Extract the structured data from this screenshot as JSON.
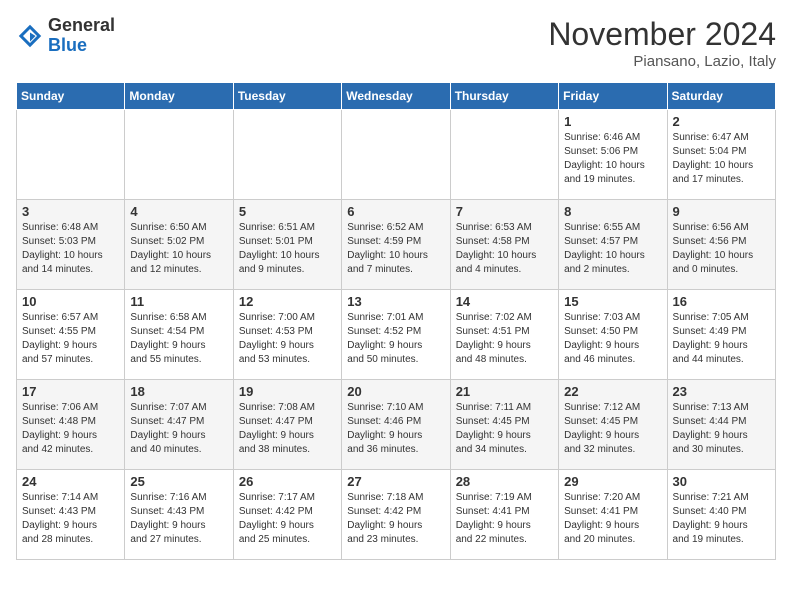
{
  "header": {
    "logo_general": "General",
    "logo_blue": "Blue",
    "month_title": "November 2024",
    "subtitle": "Piansano, Lazio, Italy"
  },
  "weekdays": [
    "Sunday",
    "Monday",
    "Tuesday",
    "Wednesday",
    "Thursday",
    "Friday",
    "Saturday"
  ],
  "weeks": [
    [
      {
        "day": "",
        "info": ""
      },
      {
        "day": "",
        "info": ""
      },
      {
        "day": "",
        "info": ""
      },
      {
        "day": "",
        "info": ""
      },
      {
        "day": "",
        "info": ""
      },
      {
        "day": "1",
        "info": "Sunrise: 6:46 AM\nSunset: 5:06 PM\nDaylight: 10 hours\nand 19 minutes."
      },
      {
        "day": "2",
        "info": "Sunrise: 6:47 AM\nSunset: 5:04 PM\nDaylight: 10 hours\nand 17 minutes."
      }
    ],
    [
      {
        "day": "3",
        "info": "Sunrise: 6:48 AM\nSunset: 5:03 PM\nDaylight: 10 hours\nand 14 minutes."
      },
      {
        "day": "4",
        "info": "Sunrise: 6:50 AM\nSunset: 5:02 PM\nDaylight: 10 hours\nand 12 minutes."
      },
      {
        "day": "5",
        "info": "Sunrise: 6:51 AM\nSunset: 5:01 PM\nDaylight: 10 hours\nand 9 minutes."
      },
      {
        "day": "6",
        "info": "Sunrise: 6:52 AM\nSunset: 4:59 PM\nDaylight: 10 hours\nand 7 minutes."
      },
      {
        "day": "7",
        "info": "Sunrise: 6:53 AM\nSunset: 4:58 PM\nDaylight: 10 hours\nand 4 minutes."
      },
      {
        "day": "8",
        "info": "Sunrise: 6:55 AM\nSunset: 4:57 PM\nDaylight: 10 hours\nand 2 minutes."
      },
      {
        "day": "9",
        "info": "Sunrise: 6:56 AM\nSunset: 4:56 PM\nDaylight: 10 hours\nand 0 minutes."
      }
    ],
    [
      {
        "day": "10",
        "info": "Sunrise: 6:57 AM\nSunset: 4:55 PM\nDaylight: 9 hours\nand 57 minutes."
      },
      {
        "day": "11",
        "info": "Sunrise: 6:58 AM\nSunset: 4:54 PM\nDaylight: 9 hours\nand 55 minutes."
      },
      {
        "day": "12",
        "info": "Sunrise: 7:00 AM\nSunset: 4:53 PM\nDaylight: 9 hours\nand 53 minutes."
      },
      {
        "day": "13",
        "info": "Sunrise: 7:01 AM\nSunset: 4:52 PM\nDaylight: 9 hours\nand 50 minutes."
      },
      {
        "day": "14",
        "info": "Sunrise: 7:02 AM\nSunset: 4:51 PM\nDaylight: 9 hours\nand 48 minutes."
      },
      {
        "day": "15",
        "info": "Sunrise: 7:03 AM\nSunset: 4:50 PM\nDaylight: 9 hours\nand 46 minutes."
      },
      {
        "day": "16",
        "info": "Sunrise: 7:05 AM\nSunset: 4:49 PM\nDaylight: 9 hours\nand 44 minutes."
      }
    ],
    [
      {
        "day": "17",
        "info": "Sunrise: 7:06 AM\nSunset: 4:48 PM\nDaylight: 9 hours\nand 42 minutes."
      },
      {
        "day": "18",
        "info": "Sunrise: 7:07 AM\nSunset: 4:47 PM\nDaylight: 9 hours\nand 40 minutes."
      },
      {
        "day": "19",
        "info": "Sunrise: 7:08 AM\nSunset: 4:47 PM\nDaylight: 9 hours\nand 38 minutes."
      },
      {
        "day": "20",
        "info": "Sunrise: 7:10 AM\nSunset: 4:46 PM\nDaylight: 9 hours\nand 36 minutes."
      },
      {
        "day": "21",
        "info": "Sunrise: 7:11 AM\nSunset: 4:45 PM\nDaylight: 9 hours\nand 34 minutes."
      },
      {
        "day": "22",
        "info": "Sunrise: 7:12 AM\nSunset: 4:45 PM\nDaylight: 9 hours\nand 32 minutes."
      },
      {
        "day": "23",
        "info": "Sunrise: 7:13 AM\nSunset: 4:44 PM\nDaylight: 9 hours\nand 30 minutes."
      }
    ],
    [
      {
        "day": "24",
        "info": "Sunrise: 7:14 AM\nSunset: 4:43 PM\nDaylight: 9 hours\nand 28 minutes."
      },
      {
        "day": "25",
        "info": "Sunrise: 7:16 AM\nSunset: 4:43 PM\nDaylight: 9 hours\nand 27 minutes."
      },
      {
        "day": "26",
        "info": "Sunrise: 7:17 AM\nSunset: 4:42 PM\nDaylight: 9 hours\nand 25 minutes."
      },
      {
        "day": "27",
        "info": "Sunrise: 7:18 AM\nSunset: 4:42 PM\nDaylight: 9 hours\nand 23 minutes."
      },
      {
        "day": "28",
        "info": "Sunrise: 7:19 AM\nSunset: 4:41 PM\nDaylight: 9 hours\nand 22 minutes."
      },
      {
        "day": "29",
        "info": "Sunrise: 7:20 AM\nSunset: 4:41 PM\nDaylight: 9 hours\nand 20 minutes."
      },
      {
        "day": "30",
        "info": "Sunrise: 7:21 AM\nSunset: 4:40 PM\nDaylight: 9 hours\nand 19 minutes."
      }
    ]
  ]
}
